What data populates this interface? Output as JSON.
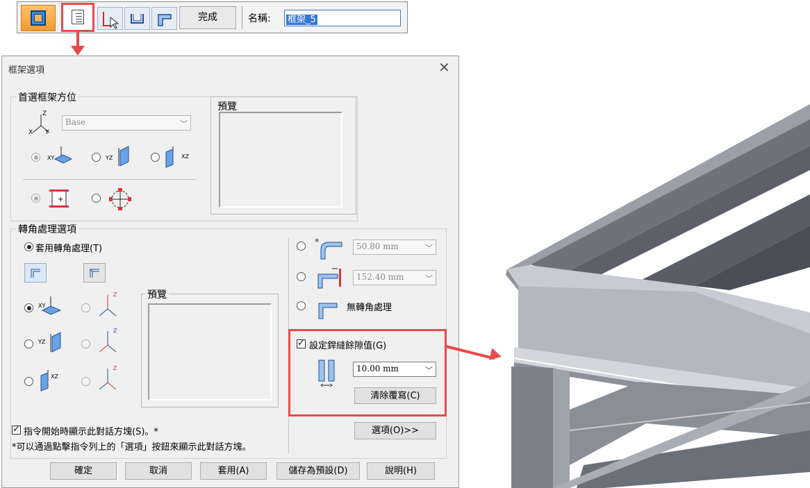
{
  "command_bar": {
    "finish_label": "完成",
    "name_label": "名稱:",
    "name_value": "框架_5"
  },
  "dialog": {
    "title": "框架選項",
    "frame_orientation": {
      "group_label": "首選框架方位",
      "axis_labels": {
        "z": "Z",
        "x": "X",
        "y": "Y"
      },
      "base_combo": "Base",
      "preview_label": "預覽",
      "plane_labels": {
        "xy": "XY",
        "yz": "YZ",
        "xz": "XZ"
      }
    },
    "corner": {
      "group_label": "轉角處理選項",
      "apply_label": "套用轉角處理(T)",
      "preview_label": "預覽",
      "radius_value": "50.80 mm",
      "setback_value": "152.40 mm",
      "no_corner_label": "無轉角處理"
    },
    "weld_gap": {
      "checkbox_label": "設定銲縫餘隙值(G)",
      "value": "10.00 mm",
      "clear_label": "清除覆寫(C)"
    },
    "show_dialog_label": "指令開始時顯示此對話方塊(S)。*",
    "options_button": "選項(O)>>",
    "footnote": "*可以通過點擊指令列上的「選項」按鈕來顯示此對話方塊。",
    "buttons": {
      "ok": "確定",
      "cancel": "取消",
      "apply": "套用(A)",
      "save_default": "儲存為預設(D)",
      "help": "說明(H)"
    }
  },
  "colors": {
    "highlight": "#e94a49",
    "accent": "#3477d3",
    "beam": "#8a8e99"
  },
  "icons": [
    "frame-command-icon",
    "frame-options-icon",
    "select-path-icon",
    "u-channel-icon",
    "corner-profile-icon",
    "close-icon",
    "coordinate-axes-icon",
    "chevron-down-icon",
    "weld-gap-icon"
  ]
}
